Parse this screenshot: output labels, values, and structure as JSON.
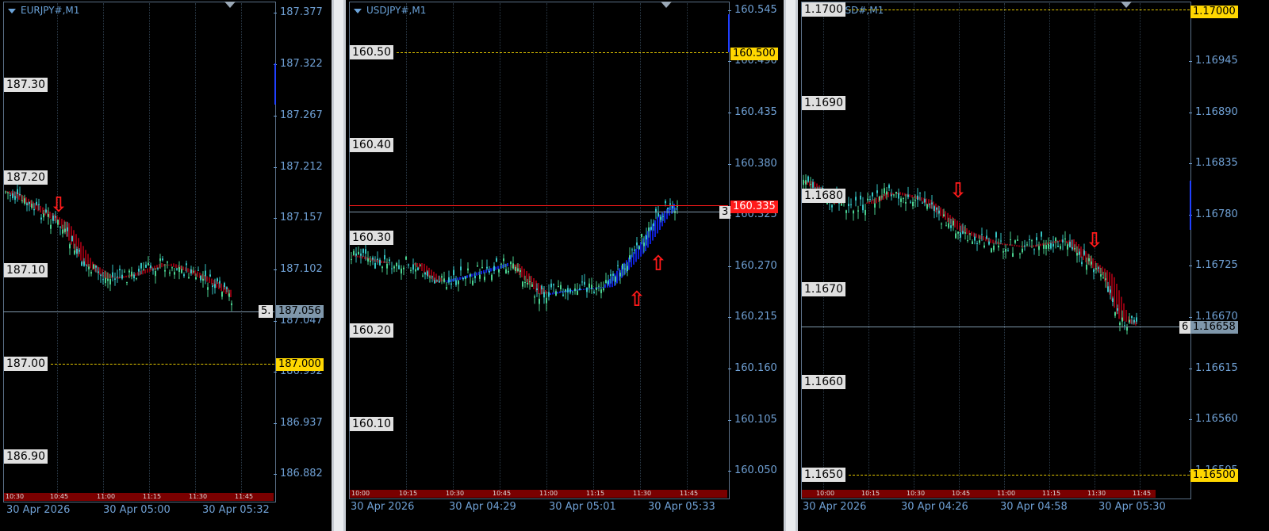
{
  "panels": [
    {
      "symbol": "EURJPY#,M1",
      "price_axis": [
        "187.377",
        "187.322",
        "187.267",
        "187.212",
        "187.157",
        "187.102",
        "187.047",
        "186.992",
        "186.937",
        "186.882"
      ],
      "round_labels": [
        "187.30",
        "187.20",
        "187.10",
        "187.00",
        "186.90"
      ],
      "bid_tag": "187.056",
      "bid_prefix": "5.",
      "level_tag": "187.000",
      "time_ticks": [
        "10:30",
        "10:45",
        "11:00",
        "11:15",
        "11:30",
        "11:45"
      ],
      "time_axis": [
        "30 Apr 2026",
        "30 Apr 05:00",
        "30 Apr 05:32"
      ],
      "arrows": [
        "⇩"
      ]
    },
    {
      "symbol": "USDJPY#,M1",
      "price_axis": [
        "160.545",
        "160.490",
        "160.435",
        "160.380",
        "160.325",
        "160.270",
        "160.215",
        "160.160",
        "160.105",
        "160.050"
      ],
      "round_labels": [
        "160.50",
        "160.40",
        "160.30",
        "160.20",
        "160.10"
      ],
      "bid_tag": "160.335",
      "bid_prefix": "3",
      "level_tag": "160.500",
      "time_ticks": [
        "10:00",
        "10:15",
        "10:30",
        "10:45",
        "11:00",
        "11:15",
        "11:30",
        "11:45"
      ],
      "time_axis": [
        "30 Apr 2026",
        "30 Apr 04:29",
        "30 Apr 05:01",
        "30 Apr 05:33"
      ],
      "arrows": [
        "⇧",
        "⇧"
      ]
    },
    {
      "symbol": "EURUSD#,M1",
      "price_axis": [
        "1.16945",
        "1.16890",
        "1.16835",
        "1.16780",
        "1.16725",
        "1.16670",
        "1.16615",
        "1.16560",
        "1.16505"
      ],
      "round_labels": [
        "1.1700",
        "1.1690",
        "1.1680",
        "1.1670",
        "1.1660",
        "1.1650"
      ],
      "bid_tag": "1.16658",
      "bid_prefix": "6",
      "level_tags": [
        "1.17000",
        "1.16500"
      ],
      "time_ticks": [
        "10:00",
        "10:15",
        "10:30",
        "10:45",
        "11:00",
        "11:15",
        "11:30",
        "11:45"
      ],
      "time_axis": [
        "30 Apr 2026",
        "30 Apr 04:26",
        "30 Apr 04:58",
        "30 Apr 05:30"
      ],
      "arrows": [
        "⇩",
        "⇩"
      ]
    }
  ],
  "colors": {
    "bull": "#4ad18f",
    "bear": "#35c3c3",
    "ribbon_up": "#0f1fd4",
    "ribbon_down": "#8a0010",
    "bid_line": "#7f97ab",
    "level": "#ffd700",
    "alert": "#ff1a1a"
  }
}
